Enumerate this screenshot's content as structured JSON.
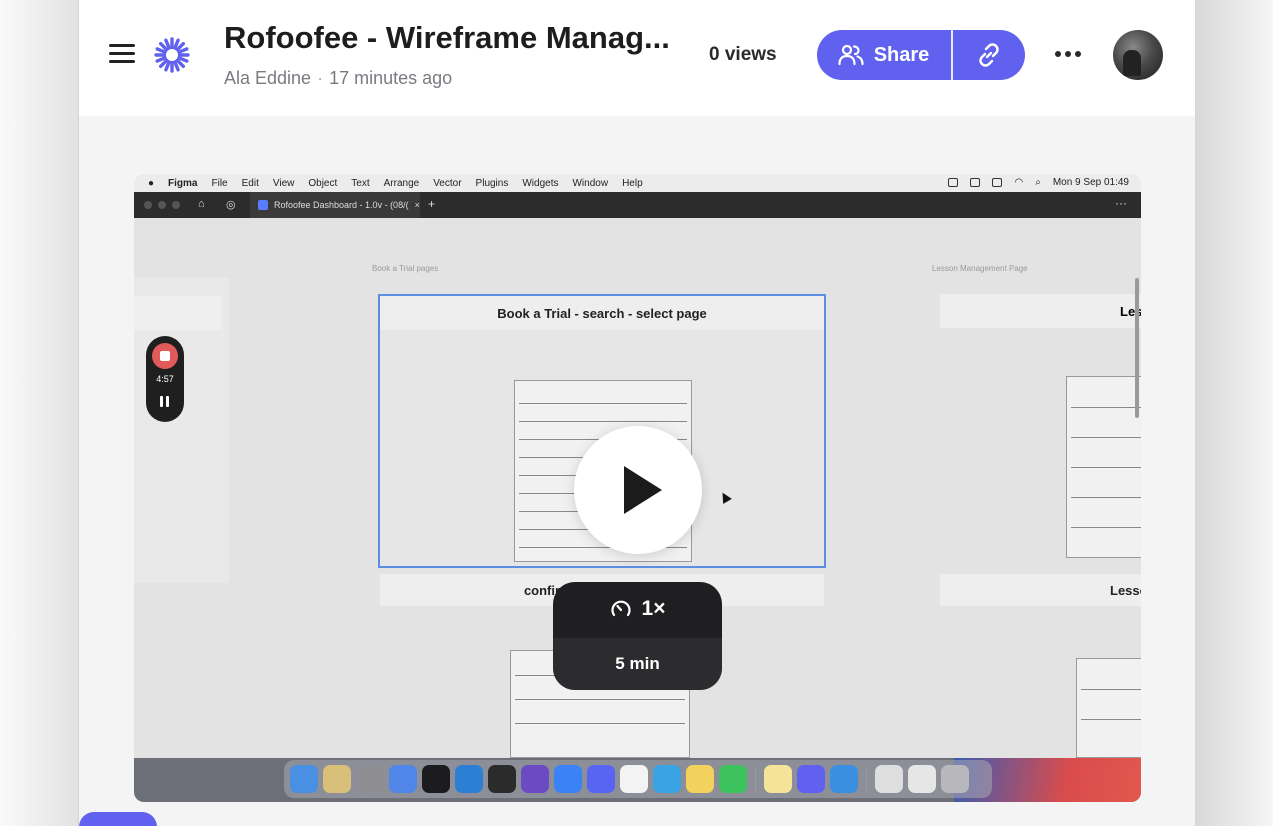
{
  "header": {
    "title": "Rofoofee - Wireframe Manag...",
    "author": "Ala Eddine",
    "separator": "·",
    "time_ago": "17 minutes ago",
    "views": "0 views",
    "share_label": "Share"
  },
  "video": {
    "mac_menubar": {
      "app": "Figma",
      "items": [
        "File",
        "Edit",
        "View",
        "Object",
        "Text",
        "Arrange",
        "Vector",
        "Plugins",
        "Widgets",
        "Window",
        "Help"
      ],
      "clock": "Mon 9 Sep  01:49"
    },
    "figma_tab": "Rofoofee Dashboard - 1.0v - (08/(",
    "frame_labels": {
      "left": "Book a Trial pages",
      "right": "Lesson Management Page"
    },
    "main_frame_title": "Book a Trial - search - select page",
    "right_frame_title_partial": "Les",
    "caption_left": "confir",
    "caption_right": "Lessc",
    "recorder_time": "4:57",
    "speed": "1×",
    "duration": "5 min"
  },
  "colors": {
    "accent": "#6161f0",
    "record": "#e25b5b",
    "frame_select": "#5b8de0"
  },
  "icons": {
    "menu": "hamburger-icon",
    "logo": "loom-logo-icon",
    "share": "users-icon",
    "link": "link-icon",
    "more": "more-horizontal-icon",
    "play": "play-icon",
    "speed": "gauge-icon"
  }
}
